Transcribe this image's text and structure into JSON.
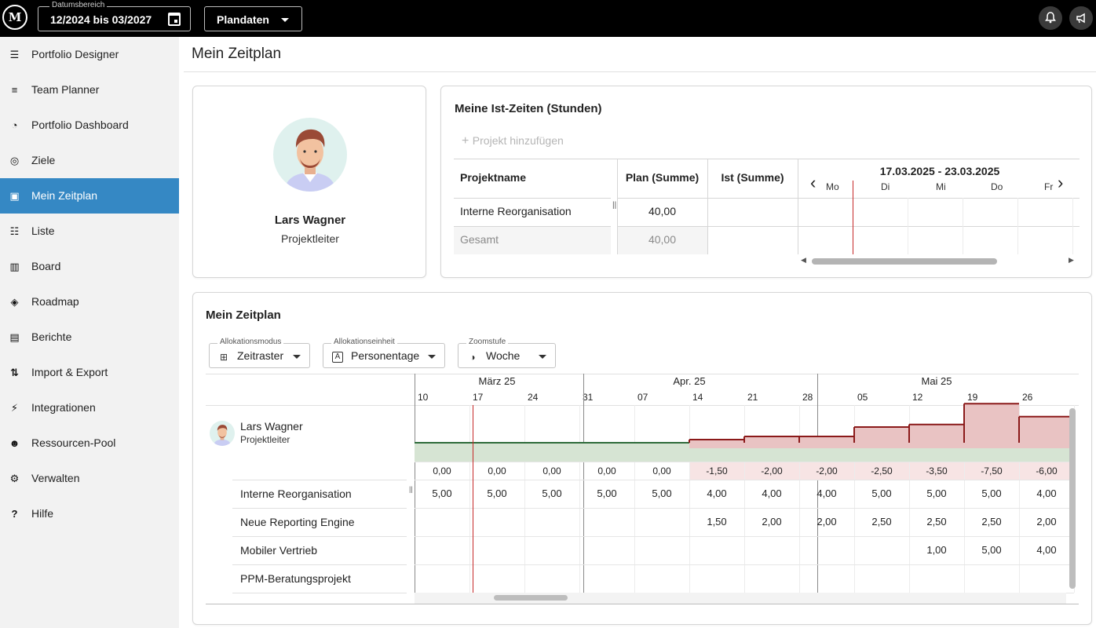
{
  "topbar": {
    "logo": "M",
    "date_range_label": "Datumsbereich",
    "date_range_value": "12/2024 bis 03/2027",
    "data_selector": "Plandaten"
  },
  "sidebar": {
    "items": [
      {
        "label": "Portfolio Designer",
        "icon": "portfolio-designer-icon",
        "glyph": "☰"
      },
      {
        "label": "Team Planner",
        "icon": "team-planner-icon",
        "glyph": "≡"
      },
      {
        "label": "Portfolio Dashboard",
        "icon": "dashboard-icon",
        "glyph": "◔"
      },
      {
        "label": "Ziele",
        "icon": "target-icon",
        "glyph": "◎"
      },
      {
        "label": "Mein Zeitplan",
        "icon": "schedule-icon",
        "glyph": "▣"
      },
      {
        "label": "Liste",
        "icon": "list-icon",
        "glyph": "☷"
      },
      {
        "label": "Board",
        "icon": "board-icon",
        "glyph": "▥"
      },
      {
        "label": "Roadmap",
        "icon": "roadmap-icon",
        "glyph": "◈"
      },
      {
        "label": "Berichte",
        "icon": "report-icon",
        "glyph": "▤"
      },
      {
        "label": "Import & Export",
        "icon": "import-export-icon",
        "glyph": "⇅"
      },
      {
        "label": "Integrationen",
        "icon": "plug-icon",
        "glyph": "⚡"
      },
      {
        "label": "Ressourcen-Pool",
        "icon": "people-icon",
        "glyph": "☻"
      },
      {
        "label": "Verwalten",
        "icon": "gear-icon",
        "glyph": "⚙"
      },
      {
        "label": "Hilfe",
        "icon": "help-icon",
        "glyph": "?"
      }
    ],
    "active_index": 4
  },
  "page": {
    "title": "Mein Zeitplan"
  },
  "profile": {
    "name": "Lars Wagner",
    "role": "Projektleiter"
  },
  "ist": {
    "title": "Meine Ist-Zeiten (Stunden)",
    "add_project": "Projekt hinzufügen",
    "headers": {
      "project": "Projektname",
      "plan": "Plan (Summe)",
      "ist": "Ist (Summe)"
    },
    "week_range": "17.03.2025 - 23.03.2025",
    "days": [
      "Mo",
      "Di",
      "Mi",
      "Do",
      "Fr"
    ],
    "rows": [
      {
        "name": "Interne Reorganisation",
        "plan": "40,00",
        "ist": ""
      }
    ],
    "total": {
      "name": "Gesamt",
      "plan": "40,00",
      "ist": ""
    }
  },
  "zeitplan": {
    "title": "Mein Zeitplan",
    "selects": [
      {
        "label": "Allokationsmodus",
        "value": "Zeitraster",
        "icon": "grid-icon",
        "glyph": "⊞"
      },
      {
        "label": "Allokationseinheit",
        "value": "Personentage",
        "icon": "unit-icon",
        "glyph": "A"
      },
      {
        "label": "Zoomstufe",
        "value": "Woche",
        "icon": "zoom-icon",
        "glyph": "◑"
      }
    ],
    "months": [
      "März 25",
      "Apr. 25",
      "Mai 25"
    ],
    "weeks": [
      "10",
      "17",
      "24",
      "31",
      "07",
      "14",
      "21",
      "28",
      "05",
      "12",
      "19",
      "26"
    ],
    "person": {
      "name": "Lars Wagner",
      "role": "Projektleiter"
    },
    "capacity": 5.0,
    "deltas": [
      "0,00",
      "0,00",
      "0,00",
      "0,00",
      "0,00",
      "-1,50",
      "-2,00",
      "-2,00",
      "-2,50",
      "-3,50",
      "-7,50",
      "-6,00"
    ],
    "projects": [
      {
        "name": "Interne Reorganisation",
        "values": [
          "5,00",
          "5,00",
          "5,00",
          "5,00",
          "5,00",
          "4,00",
          "4,00",
          "4,00",
          "5,00",
          "5,00",
          "5,00",
          "4,00"
        ]
      },
      {
        "name": "Neue Reporting Engine",
        "values": [
          "",
          "",
          "",
          "",
          "",
          "1,50",
          "2,00",
          "2,00",
          "2,50",
          "2,50",
          "2,50",
          "2,00"
        ]
      },
      {
        "name": "Mobiler Vertrieb",
        "values": [
          "",
          "",
          "",
          "",
          "",
          "",
          "",
          "",
          "",
          "1,00",
          "5,00",
          "4,00"
        ]
      },
      {
        "name": "PPM-Beratungsprojekt",
        "values": [
          "",
          "",
          "",
          "",
          "",
          "",
          "",
          "",
          "",
          "",
          "",
          ""
        ]
      }
    ],
    "colors": {
      "over": "#e9c3c3",
      "over_line": "#8b1a1a",
      "ok": "#d6e4d3",
      "ok_line": "#2e6b3a",
      "today": "#c62828"
    }
  }
}
